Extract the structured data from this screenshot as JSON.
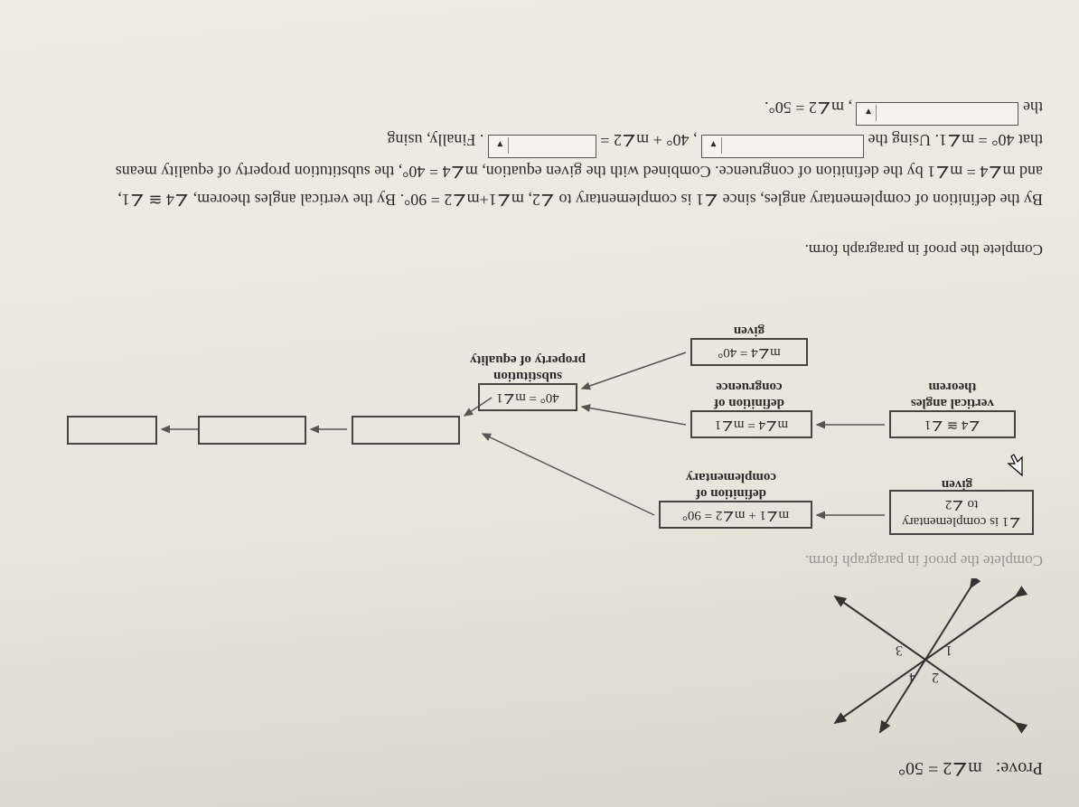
{
  "prove_label": "Prove:",
  "prove_statement": "m∠2 = 50°",
  "diagram": {
    "angle_labels": [
      "1",
      "2",
      "3",
      "4"
    ]
  },
  "instruction_faint": "Complete the proof in paragraph form.",
  "instruction": "Complete the proof in paragraph form.",
  "flow": {
    "n1": "∠1 is complementary to ∠2",
    "r1": "given",
    "n2": "m∠1 + m∠2 = 90°",
    "r2": "definition of complementary",
    "n3": "∠4 ≅ ∠1",
    "r3": "vertical angles theorem",
    "n4": "m∠4 = m∠1",
    "r4": "definition of congruence",
    "n5": "m∠4 = 40°",
    "r5": "given",
    "n6": "40° = m∠1",
    "r6": "substitution property of equality"
  },
  "paragraph": {
    "p1": "By the definition of complementary angles, since ∠1 is complementary to ∠2, m∠1+m∠2 = 90°. By the vertical angles theorem, ∠4 ≅ ∠1,",
    "p2": "and m∠4 = m∠1 by the definition of congruence. Combined with the given equation, m∠4 = 40°, the substitution property of equality means",
    "p3a": "that 40° = m∠1. Using the",
    "p3b": ", 40° + m∠2 =",
    "p3c": ". Finally, using",
    "p4a": "the",
    "p4b": ", m∠2 = 50°."
  },
  "dropdown_blank": ""
}
